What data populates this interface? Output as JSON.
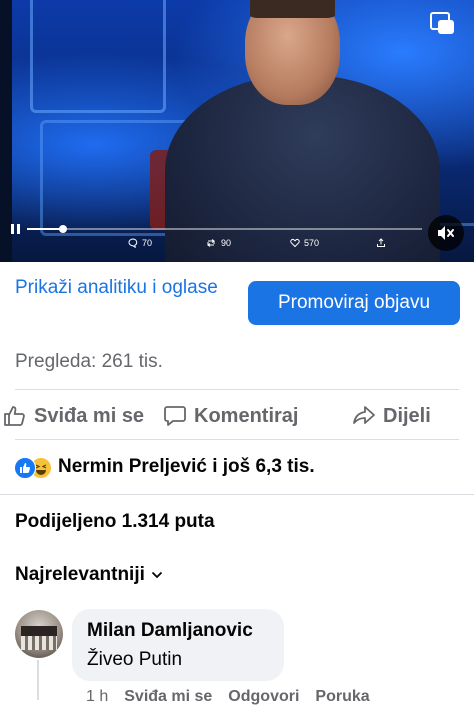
{
  "video": {
    "stats": {
      "comments": "70",
      "reposts": "90",
      "likes": "570"
    },
    "progress": 0.09,
    "icons": {
      "pip": "picture-in-picture-icon",
      "pause": "pause-icon",
      "comment": "comment-bubble-icon",
      "repost": "repost-icon",
      "like": "heart-icon",
      "share": "share-icon",
      "mute": "speaker-muted-icon"
    }
  },
  "actions": {
    "analytics_label": "Prikaži analitiku i oglase",
    "promote_label": "Promoviraj objavu"
  },
  "views_label": "Pregleda: 261 tis.",
  "action_bar": {
    "like_label": "Sviđa mi se",
    "comment_label": "Komentiraj",
    "share_label": "Dijeli"
  },
  "reactions": {
    "summary": "Nermin Preljević i još 6,3 tis.",
    "types": [
      "like",
      "haha"
    ]
  },
  "shares_label": "Podijeljeno 1.314 puta",
  "sort_label": "Najrelevantniji",
  "comment": {
    "author": "Milan Damljanovic",
    "text": "Živeo Putin",
    "time": "1 h",
    "like_label": "Sviđa mi se",
    "reply_label": "Odgovori",
    "message_label": "Poruka"
  },
  "colors": {
    "accent": "#1b74e4",
    "secondary_text": "#65676b",
    "bubble_bg": "#f0f2f5"
  }
}
